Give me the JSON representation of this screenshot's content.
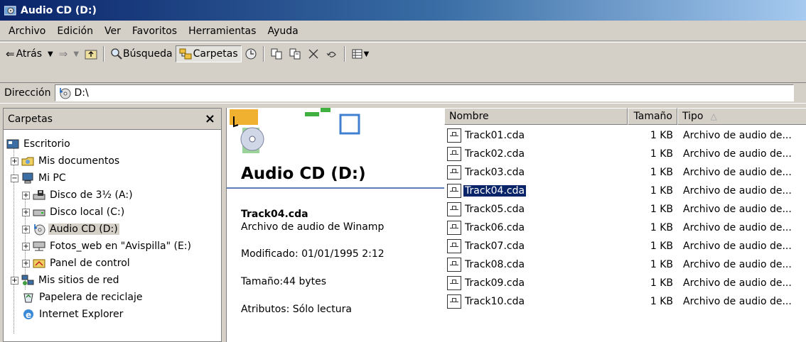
{
  "window": {
    "title": "Audio CD (D:)"
  },
  "menu": [
    "Archivo",
    "Edición",
    "Ver",
    "Favoritos",
    "Herramientas",
    "Ayuda"
  ],
  "toolbar": {
    "back_label": "Atrás",
    "search_label": "Búsqueda",
    "folders_label": "Carpetas"
  },
  "address": {
    "label": "Dirección",
    "value": "D:\\"
  },
  "folders_pane": {
    "title": "Carpetas",
    "close": "×",
    "tree": [
      {
        "label": "Escritorio",
        "icon": "desktop-icon"
      },
      {
        "label": "Mis documentos",
        "icon": "my-documents-icon",
        "expander": "+"
      },
      {
        "label": "Mi PC",
        "icon": "my-computer-icon",
        "expander": "−"
      },
      {
        "label": "Disco de 3½ (A:)",
        "icon": "floppy-icon",
        "expander": "+"
      },
      {
        "label": "Disco local (C:)",
        "icon": "hard-disk-icon",
        "expander": "+"
      },
      {
        "label": "Audio CD (D:)",
        "icon": "audio-cd-icon",
        "expander": "+",
        "selected": true
      },
      {
        "label": "Fotos_web en \"Avispilla\" (E:)",
        "icon": "network-drive-icon",
        "expander": "+"
      },
      {
        "label": "Panel de control",
        "icon": "control-panel-icon",
        "expander": "+"
      },
      {
        "label": "Mis sitios de red",
        "icon": "network-places-icon",
        "expander": "+"
      },
      {
        "label": "Papelera de reciclaje",
        "icon": "recycle-bin-icon"
      },
      {
        "label": "Internet Explorer",
        "icon": "ie-icon"
      }
    ]
  },
  "webview": {
    "title": "Audio CD (D:)",
    "selected_name": "Track04.cda",
    "selected_type": "Archivo de audio de Winamp",
    "modified": "Modificado: 01/01/1995 2:12",
    "size": "Tamaño:44 bytes",
    "attributes": "Atributos: Sólo lectura"
  },
  "list": {
    "columns": {
      "name": "Nombre",
      "size": "Tamaño",
      "type": "Tipo",
      "sort_indicator": "△"
    },
    "rows": [
      {
        "name": "Track01.cda",
        "size": "1 KB",
        "type": "Archivo de audio de..."
      },
      {
        "name": "Track02.cda",
        "size": "1 KB",
        "type": "Archivo de audio de..."
      },
      {
        "name": "Track03.cda",
        "size": "1 KB",
        "type": "Archivo de audio de..."
      },
      {
        "name": "Track04.cda",
        "size": "1 KB",
        "type": "Archivo de audio de...",
        "selected": true
      },
      {
        "name": "Track05.cda",
        "size": "1 KB",
        "type": "Archivo de audio de..."
      },
      {
        "name": "Track06.cda",
        "size": "1 KB",
        "type": "Archivo de audio de..."
      },
      {
        "name": "Track07.cda",
        "size": "1 KB",
        "type": "Archivo de audio de..."
      },
      {
        "name": "Track08.cda",
        "size": "1 KB",
        "type": "Archivo de audio de..."
      },
      {
        "name": "Track09.cda",
        "size": "1 KB",
        "type": "Archivo de audio de..."
      },
      {
        "name": "Track10.cda",
        "size": "1 KB",
        "type": "Archivo de audio de..."
      }
    ]
  },
  "colors": {
    "title_bar": "#0a246a",
    "selection": "#0a246a",
    "face": "#d4d0c8"
  }
}
